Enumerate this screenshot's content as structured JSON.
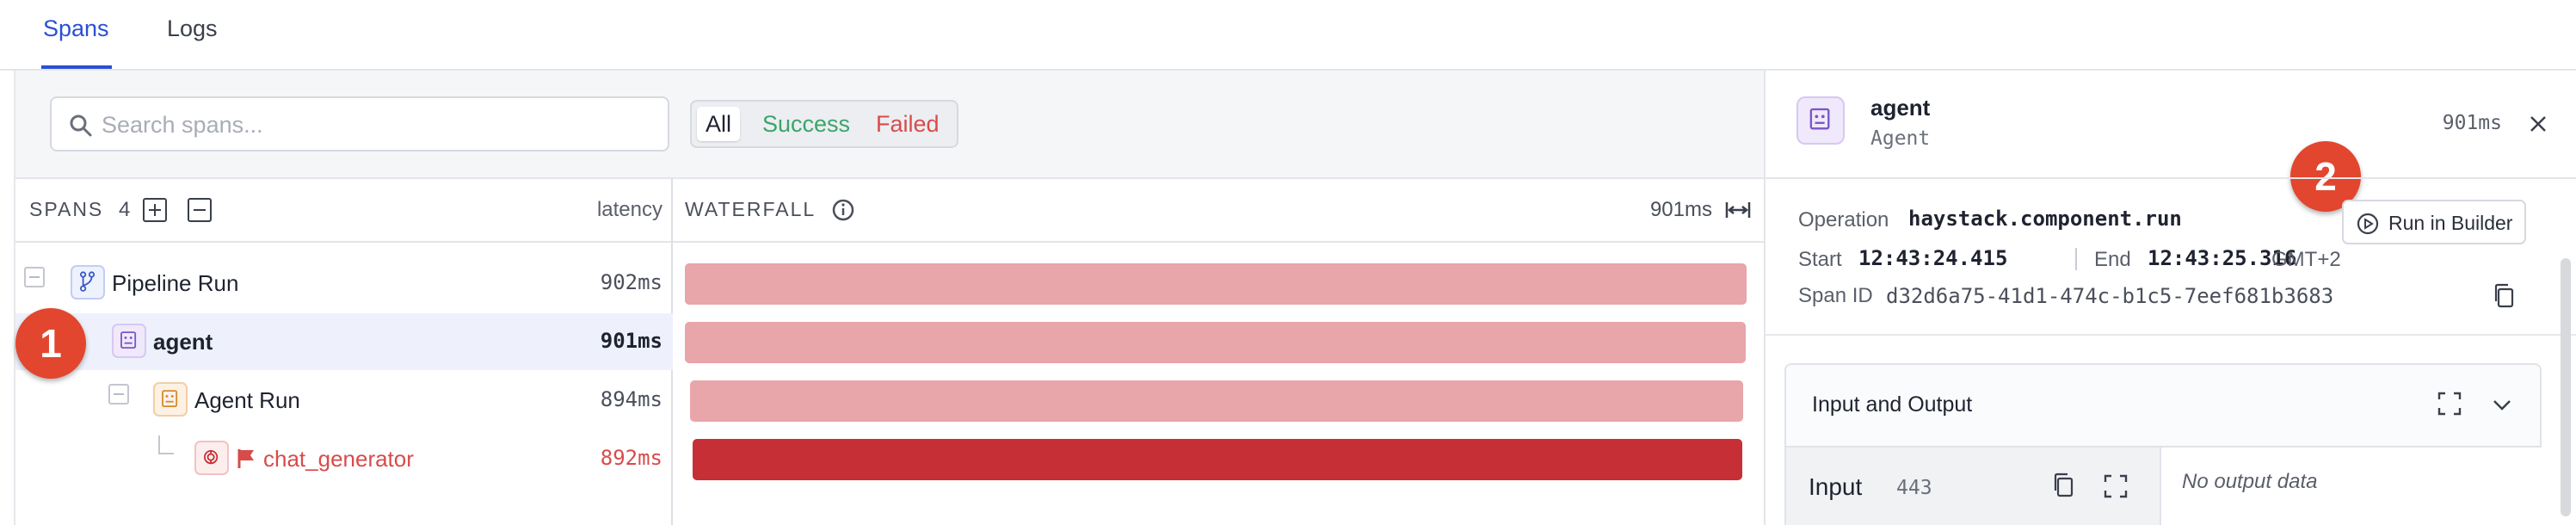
{
  "tabs": {
    "spans": "Spans",
    "logs": "Logs"
  },
  "filter": {
    "search_placeholder": "Search spans...",
    "all": "All",
    "success": "Success",
    "failed": "Failed"
  },
  "spans_panel": {
    "title": "SPANS",
    "count": "4",
    "latency_label": "latency"
  },
  "waterfall": {
    "title": "WATERFALL",
    "total_duration": "901ms"
  },
  "rows": [
    {
      "name": "Pipeline Run",
      "latency": "902ms",
      "status": "success",
      "bar_start": 0.0,
      "bar_end": 1.0
    },
    {
      "name": "agent",
      "latency": "901ms",
      "status": "success",
      "selected": true,
      "bar_start": 0.0,
      "bar_end": 0.999
    },
    {
      "name": "Agent Run",
      "latency": "894ms",
      "status": "success",
      "bar_start": 0.005,
      "bar_end": 0.997
    },
    {
      "name": "chat_generator",
      "latency": "892ms",
      "status": "failed",
      "bar_start": 0.007,
      "bar_end": 0.996
    }
  ],
  "markers": {
    "one": "1",
    "two": "2"
  },
  "detail": {
    "title": "agent",
    "subtitle": "Agent",
    "duration": "901ms",
    "operation_label": "Operation",
    "operation_value": "haystack.component.run",
    "run_in_builder": "Run in Builder",
    "start_label": "Start",
    "start_value": "12:43:24.415",
    "end_label": "End",
    "end_value": "12:43:25.316",
    "timezone": "GMT+2",
    "span_id_label": "Span ID",
    "span_id_value": "d32d6a75-41d1-474c-b1c5-7eef681b3683",
    "io_title": "Input and Output",
    "input_title": "Input",
    "input_count": "443",
    "output_empty": "No output data"
  },
  "colors": {
    "accent": "#2a4fd6",
    "success_bar": "#e8a5aa",
    "failed_bar": "#c62f35",
    "failed_text": "#d84b4b",
    "marker": "#e2462e"
  },
  "icons": [
    "search-icon",
    "expand-all-icon",
    "collapse-all-icon",
    "info-icon",
    "fit-width-icon",
    "branch-icon",
    "agent-icon",
    "agent-run-icon",
    "openai-icon",
    "flag-icon",
    "close-icon",
    "play-icon",
    "copy-icon",
    "expand-icon",
    "chevron-down-icon"
  ]
}
